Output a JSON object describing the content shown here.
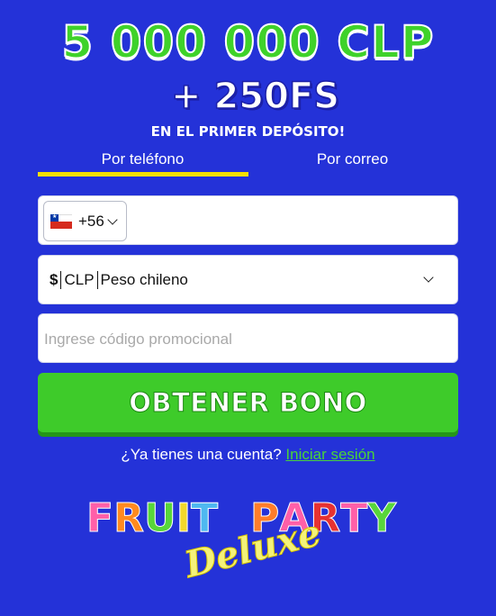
{
  "promo": {
    "headline": "5 000 000 CLP",
    "sub_headline": "+ 250FS",
    "tagline": "EN EL PRIMER DEPÓSITO!"
  },
  "tabs": [
    {
      "label": "Por teléfono",
      "active": true
    },
    {
      "label": "Por correo",
      "active": false
    }
  ],
  "phone": {
    "country_flag": "chile-flag-icon",
    "dial_code": "+56",
    "value": ""
  },
  "currency": {
    "symbol": "$",
    "code": "CLP",
    "name": "Peso chileno"
  },
  "promo_code": {
    "placeholder": "Ingrese código promocional",
    "value": ""
  },
  "bonus_button": {
    "label": "OBTENER BONO"
  },
  "account": {
    "question": "¿Ya tienes una cuenta?",
    "login_link": "Iniciar sesión"
  },
  "logo": {
    "word1": "FRUIT",
    "word2": "PARTY",
    "sub": "Deluxe"
  },
  "colors": {
    "background": "#2432d8",
    "accent_green": "#3ecb2a",
    "tab_underline": "#f5e000",
    "link": "#49d23a"
  }
}
